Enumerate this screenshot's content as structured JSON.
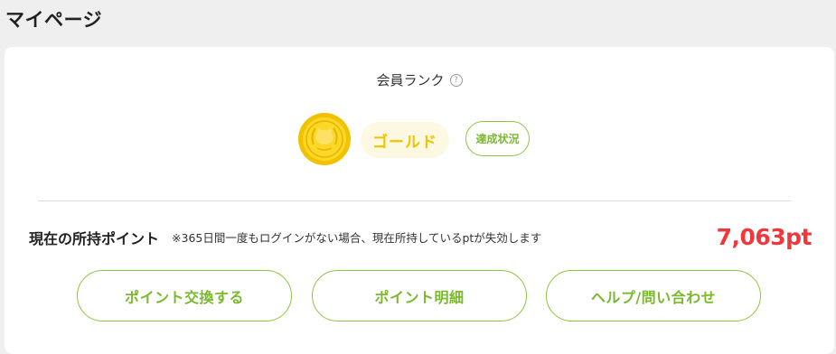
{
  "header": {
    "title": "マイページ"
  },
  "rank": {
    "label": "会員ランク",
    "help_icon": "?",
    "medal_icon": "gold-coin-icon",
    "name": "ゴールド",
    "status_button": "達成状況",
    "accent_color": "#f2c200"
  },
  "points": {
    "title": "現在の所持ポイント",
    "note": "※365日間一度もログインがない場合、現在所持しているptが失効します",
    "value": "7,063pt",
    "value_color": "#f0383c"
  },
  "actions": {
    "exchange": "ポイント交換する",
    "history": "ポイント明細",
    "help": "ヘルプ/問い合わせ",
    "button_color": "#8cc63f"
  }
}
